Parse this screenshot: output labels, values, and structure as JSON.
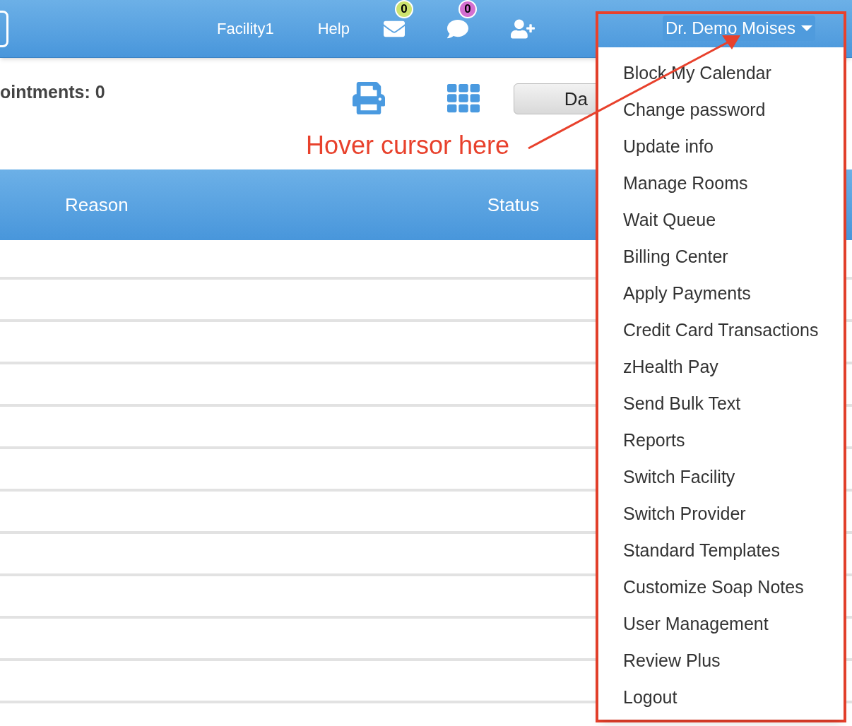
{
  "header": {
    "nav_links": [
      "Facility1",
      "Help"
    ],
    "notifications": [
      {
        "kind": "mail",
        "count": "0",
        "color": "#cde36f"
      },
      {
        "kind": "chat",
        "count": "0",
        "color": "#d46fd0"
      }
    ],
    "user_menu": {
      "label": "Dr. Demo Moises",
      "expanded": true,
      "items": [
        "Block My Calendar",
        "Change password",
        "Update info",
        "Manage Rooms",
        "Wait Queue",
        "Billing Center",
        "Apply Payments",
        "Credit Card Transactions",
        "zHealth Pay",
        "Send Bulk Text",
        "Reports",
        "Switch Facility",
        "Switch Provider",
        "Standard Templates",
        "Customize Soap Notes",
        "User Management",
        "Review Plus",
        "Logout"
      ]
    }
  },
  "toolbar": {
    "appointments_count": "ointments: 0",
    "view_button": "Da"
  },
  "table": {
    "columns": [
      "Reason",
      "Status"
    ]
  },
  "annotation": {
    "text": "Hover cursor here"
  }
}
